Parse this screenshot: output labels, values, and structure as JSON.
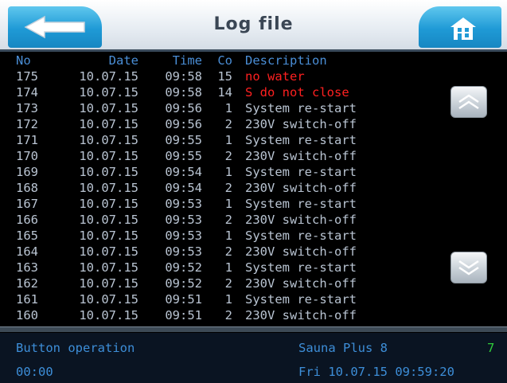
{
  "header": {
    "title": "Log file",
    "back_icon": "arrow-left-icon",
    "home_icon": "home-icon"
  },
  "table": {
    "columns": {
      "no": "No",
      "date": "Date",
      "time": "Time",
      "code": "Co",
      "description": "Description"
    },
    "rows": [
      {
        "no": "175",
        "date": "10.07.15",
        "time": "09:58",
        "code": "15",
        "description": "no water",
        "error": true
      },
      {
        "no": "174",
        "date": "10.07.15",
        "time": "09:58",
        "code": "14",
        "description": "S do not close",
        "error": true
      },
      {
        "no": "173",
        "date": "10.07.15",
        "time": "09:56",
        "code": "1",
        "description": "System re-start",
        "error": false
      },
      {
        "no": "172",
        "date": "10.07.15",
        "time": "09:56",
        "code": "2",
        "description": "230V switch-off",
        "error": false
      },
      {
        "no": "171",
        "date": "10.07.15",
        "time": "09:55",
        "code": "1",
        "description": "System re-start",
        "error": false
      },
      {
        "no": "170",
        "date": "10.07.15",
        "time": "09:55",
        "code": "2",
        "description": "230V switch-off",
        "error": false
      },
      {
        "no": "169",
        "date": "10.07.15",
        "time": "09:54",
        "code": "1",
        "description": "System re-start",
        "error": false
      },
      {
        "no": "168",
        "date": "10.07.15",
        "time": "09:54",
        "code": "2",
        "description": "230V switch-off",
        "error": false
      },
      {
        "no": "167",
        "date": "10.07.15",
        "time": "09:53",
        "code": "1",
        "description": "System re-start",
        "error": false
      },
      {
        "no": "166",
        "date": "10.07.15",
        "time": "09:53",
        "code": "2",
        "description": "230V switch-off",
        "error": false
      },
      {
        "no": "165",
        "date": "10.07.15",
        "time": "09:53",
        "code": "1",
        "description": "System re-start",
        "error": false
      },
      {
        "no": "164",
        "date": "10.07.15",
        "time": "09:53",
        "code": "2",
        "description": "230V switch-off",
        "error": false
      },
      {
        "no": "163",
        "date": "10.07.15",
        "time": "09:52",
        "code": "1",
        "description": "System re-start",
        "error": false
      },
      {
        "no": "162",
        "date": "10.07.15",
        "time": "09:52",
        "code": "2",
        "description": "230V switch-off",
        "error": false
      },
      {
        "no": "161",
        "date": "10.07.15",
        "time": "09:51",
        "code": "1",
        "description": "System re-start",
        "error": false
      },
      {
        "no": "160",
        "date": "10.07.15",
        "time": "09:51",
        "code": "2",
        "description": "230V switch-off",
        "error": false
      }
    ],
    "error_color": "#ff2020",
    "text_color": "#b9c4d2",
    "header_color": "#4a8ed6"
  },
  "scroll": {
    "up_icon": "double-chevron-up-icon",
    "down_icon": "double-chevron-down-icon"
  },
  "status": {
    "mode": "Button operation",
    "device": "Sauna Plus 8",
    "signal": "7",
    "time_left": "00:00",
    "datetime": "Fri 10.07.15 09:59:20"
  }
}
